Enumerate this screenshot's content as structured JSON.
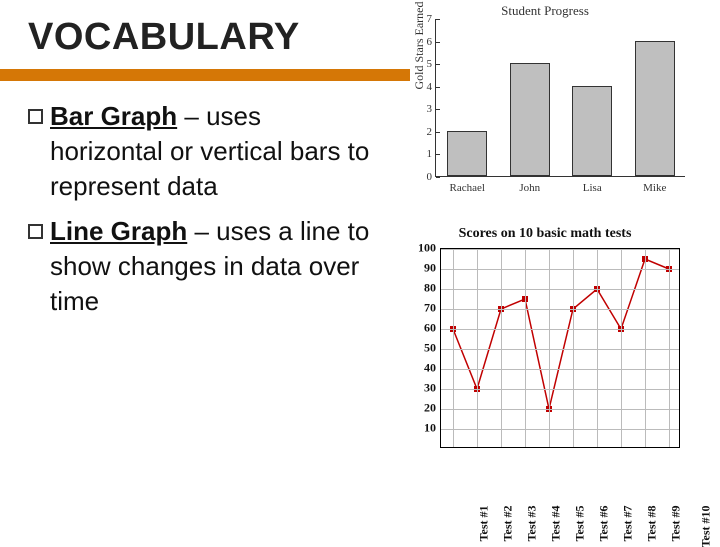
{
  "title": "VOCABULARY",
  "bullets": [
    {
      "term": "Bar Graph",
      "def": " – uses horizontal or vertical bars to represent data"
    },
    {
      "term": "Line Graph",
      "def": " – uses a line to show changes in data over time"
    }
  ],
  "chart_data": [
    {
      "type": "bar",
      "title": "Student Progress",
      "ylabel": "Gold Stars Earned This Week",
      "categories": [
        "Rachael",
        "John",
        "Lisa",
        "Mike"
      ],
      "values": [
        2,
        5,
        4,
        6
      ],
      "ylim": [
        0,
        7
      ],
      "yticks": [
        0,
        1,
        2,
        3,
        4,
        5,
        6,
        7
      ]
    },
    {
      "type": "line",
      "title": "Scores on 10 basic math tests",
      "x_labels": [
        "Test #1",
        "Test #2",
        "Test #3",
        "Test #4",
        "Test #5",
        "Test #6",
        "Test #7",
        "Test #8",
        "Test #9",
        "Test #10"
      ],
      "values": [
        60,
        30,
        70,
        75,
        20,
        70,
        80,
        60,
        95,
        90
      ],
      "ylim": [
        0,
        100
      ],
      "yticks": [
        10,
        20,
        30,
        40,
        50,
        60,
        70,
        80,
        90,
        100
      ],
      "marker_color": "#c00000",
      "line_color": "#c00000"
    }
  ]
}
